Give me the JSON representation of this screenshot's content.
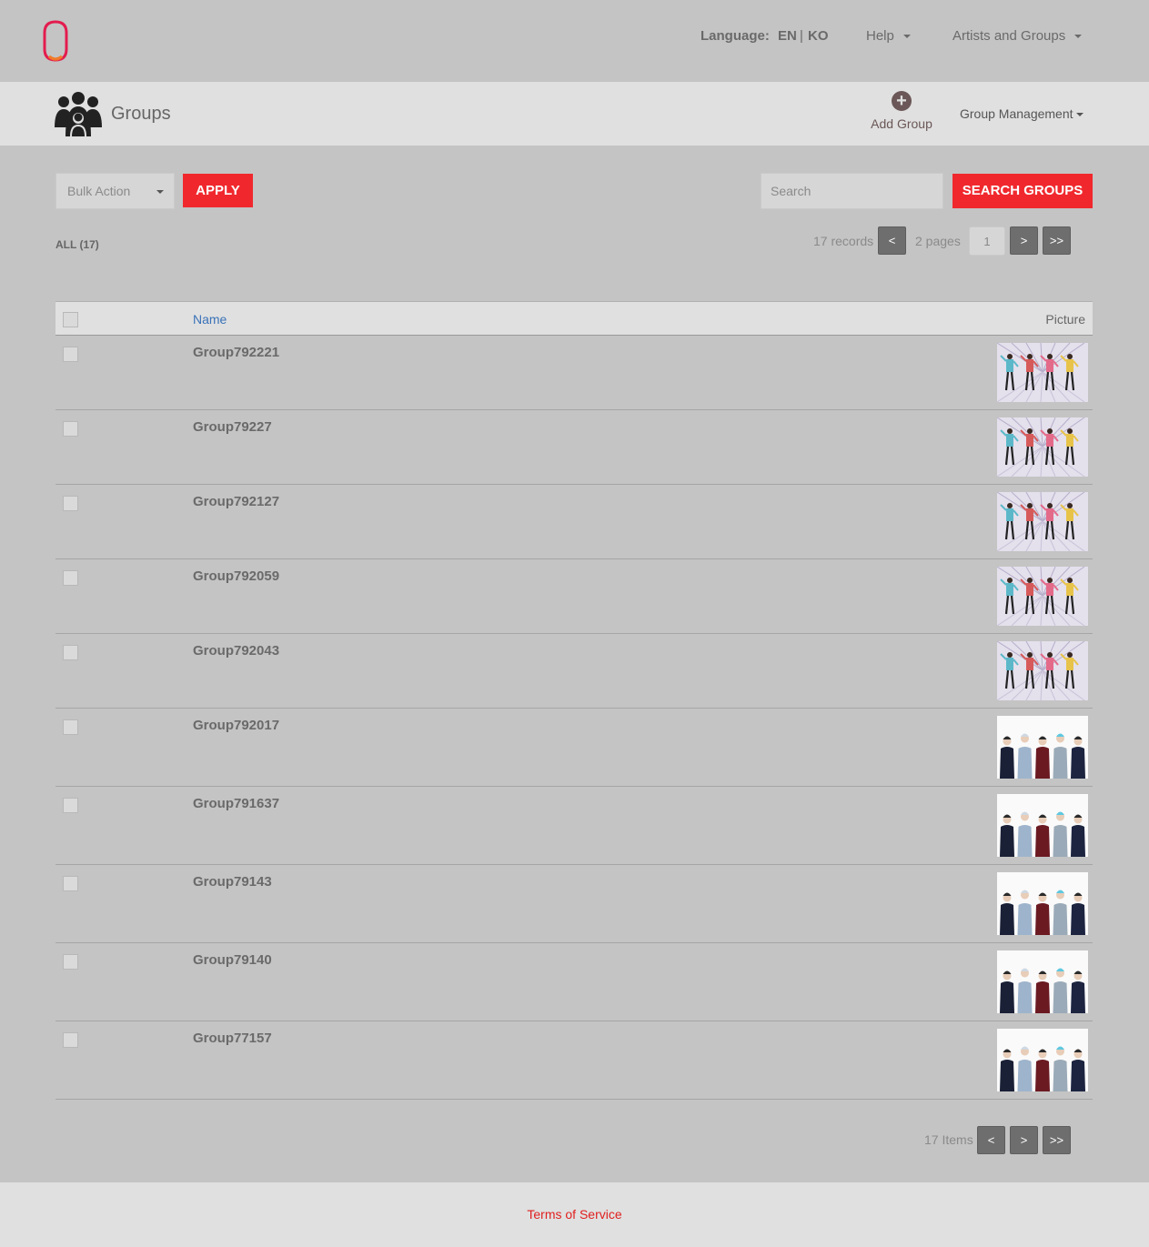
{
  "header": {
    "language_label": "Language:",
    "lang_en": "EN",
    "lang_separator": "|",
    "lang_ko": "KO",
    "help_menu": "Help",
    "artists_menu": "Artists and Groups"
  },
  "subheader": {
    "title": "Groups",
    "add_group_label": "Add Group",
    "group_management_label": "Group Management"
  },
  "toolbar": {
    "bulk_action_placeholder": "Bulk Action",
    "apply_label": "APPLY",
    "search_placeholder": "Search",
    "search_button_label": "SEARCH GROUPS"
  },
  "filters": {
    "all_label": "ALL (17)"
  },
  "pagination_top": {
    "records_label": "17 records",
    "prev_label": "<",
    "pages_label": "2 pages",
    "current_page": "1",
    "next_label": ">",
    "last_label": ">>"
  },
  "table": {
    "columns": {
      "name": "Name",
      "picture": "Picture"
    },
    "rows": [
      {
        "name": "Group792221",
        "picture": "dance-group-photo"
      },
      {
        "name": "Group79227",
        "picture": "dance-group-photo"
      },
      {
        "name": "Group792127",
        "picture": "dance-group-photo"
      },
      {
        "name": "Group792059",
        "picture": "dance-group-photo"
      },
      {
        "name": "Group792043",
        "picture": "dance-group-photo"
      },
      {
        "name": "Group792017",
        "picture": "suit-group-photo"
      },
      {
        "name": "Group791637",
        "picture": "suit-group-photo"
      },
      {
        "name": "Group79143",
        "picture": "suit-group-photo"
      },
      {
        "name": "Group79140",
        "picture": "suit-group-photo"
      },
      {
        "name": "Group77157",
        "picture": "suit-group-photo"
      }
    ]
  },
  "pagination_bottom": {
    "items_label": "17 Items",
    "prev_label": "<",
    "next_label": ">",
    "last_label": ">>"
  },
  "footer": {
    "terms_label": "Terms of Service"
  },
  "colors": {
    "accent_red": "#f0282d",
    "link_blue": "#3a72b8",
    "page_bg": "#c4c4c4",
    "bar_bg": "#e0e0e0"
  }
}
